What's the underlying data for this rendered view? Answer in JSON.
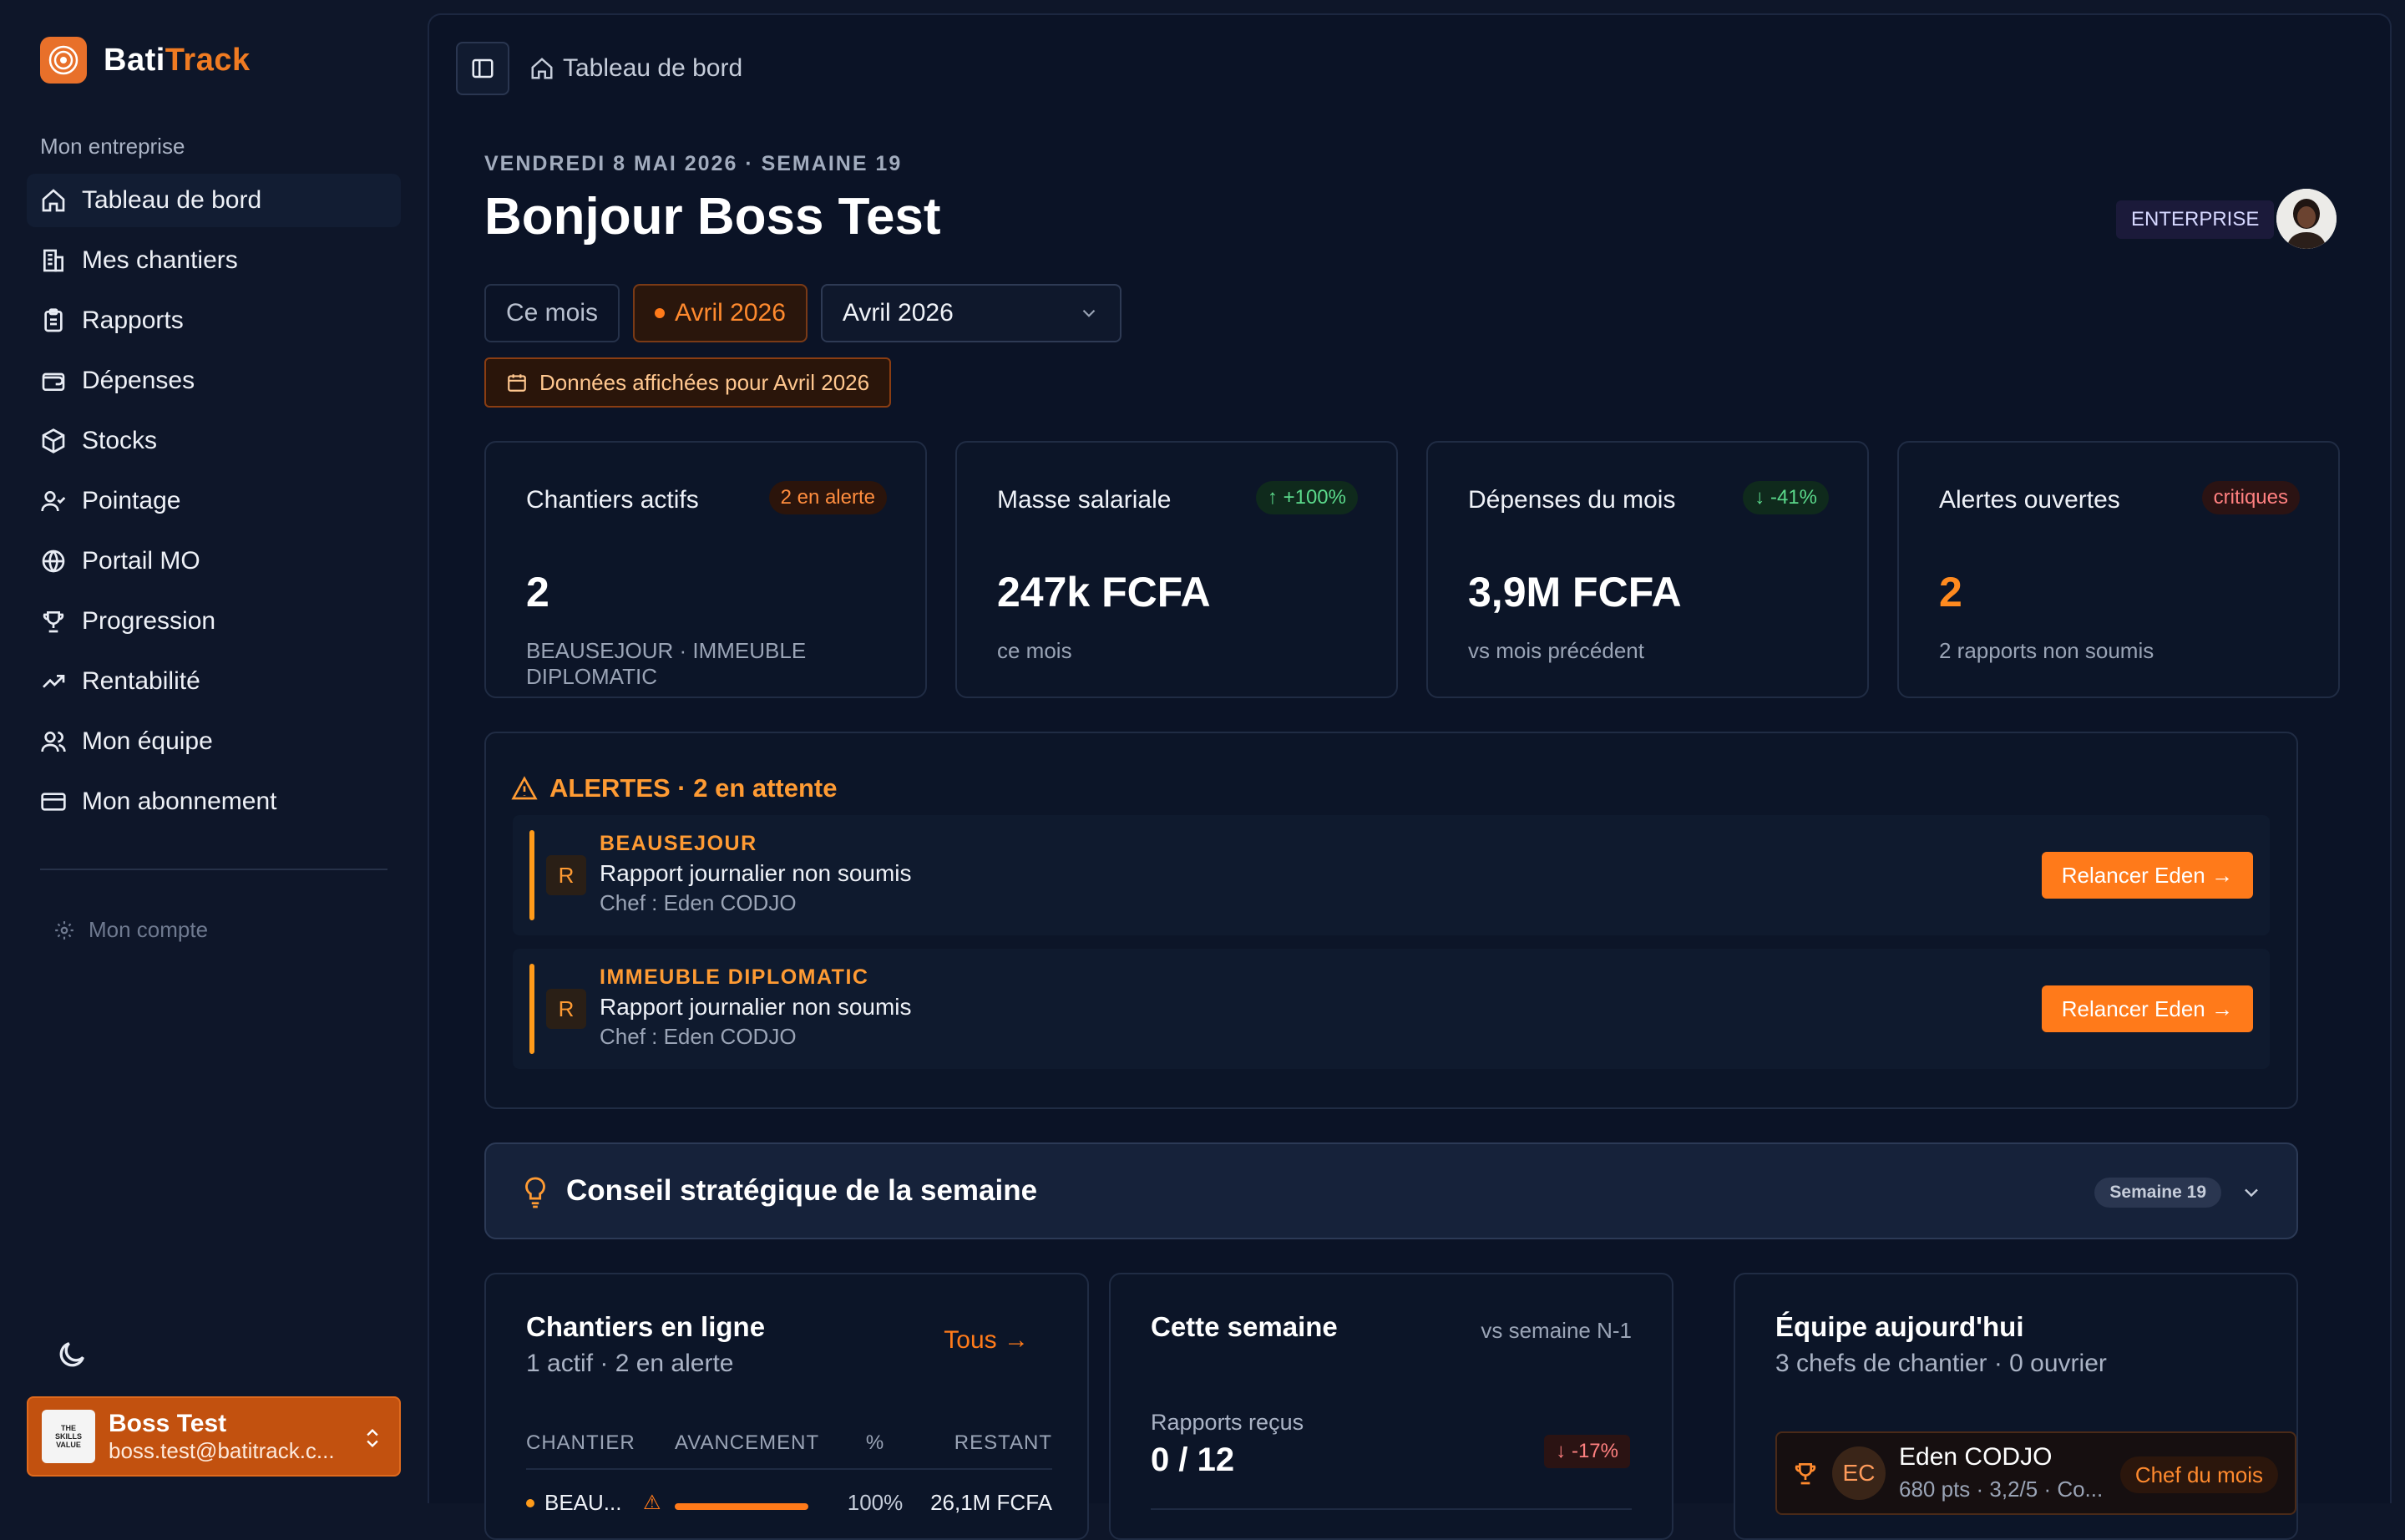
{
  "brand": {
    "part1": "Bati",
    "part2": "Track"
  },
  "sidebar": {
    "section": "Mon entreprise",
    "items": [
      {
        "label": "Tableau de bord",
        "icon": "home-icon"
      },
      {
        "label": "Mes chantiers",
        "icon": "building-icon"
      },
      {
        "label": "Rapports",
        "icon": "clipboard-icon"
      },
      {
        "label": "Dépenses",
        "icon": "wallet-icon"
      },
      {
        "label": "Stocks",
        "icon": "box-icon"
      },
      {
        "label": "Pointage",
        "icon": "user-check-icon"
      },
      {
        "label": "Portail MO",
        "icon": "globe-icon"
      },
      {
        "label": "Progression",
        "icon": "trophy-icon"
      },
      {
        "label": "Rentabilité",
        "icon": "trend-up-icon"
      },
      {
        "label": "Mon équipe",
        "icon": "users-icon"
      },
      {
        "label": "Mon abonnement",
        "icon": "credit-card-icon"
      }
    ],
    "account": "Mon compte"
  },
  "user": {
    "name": "Boss Test",
    "email": "boss.test@batitrack.c...",
    "logo_text": "THE SKILLS VALUE"
  },
  "header": {
    "breadcrumb": "Tableau de bord",
    "date": "VENDREDI 8 MAI 2026 · SEMAINE 19",
    "greeting": "Bonjour Boss Test",
    "plan": "ENTERPRISE"
  },
  "period": {
    "current": "Ce mois",
    "active": "Avril 2026",
    "select": "Avril 2026",
    "notice": "Données affichées pour Avril 2026"
  },
  "kpis": [
    {
      "title": "Chantiers actifs",
      "badge": "2 en alerte",
      "value": "2",
      "sub": "BEAUSEJOUR · IMMEUBLE DIPLOMATIC"
    },
    {
      "title": "Masse salariale",
      "badge": "↑ +100%",
      "value": "247k FCFA",
      "sub": "ce mois"
    },
    {
      "title": "Dépenses du mois",
      "badge": "↓ -41%",
      "value": "3,9M FCFA",
      "sub": "vs mois précédent"
    },
    {
      "title": "Alertes ouvertes",
      "badge": "critiques",
      "value": "2",
      "sub": "2 rapports non soumis"
    }
  ],
  "alerts": {
    "title": "ALERTES · 2 en attente",
    "items": [
      {
        "icon_letter": "R",
        "site": "BEAUSEJOUR",
        "message": "Rapport journalier non soumis",
        "chef": "Chef : Eden CODJO",
        "action": "Relancer Eden →"
      },
      {
        "icon_letter": "R",
        "site": "IMMEUBLE DIPLOMATIC",
        "message": "Rapport journalier non soumis",
        "chef": "Chef : Eden CODJO",
        "action": "Relancer Eden →"
      }
    ]
  },
  "conseil": {
    "title": "Conseil stratégique de la semaine",
    "week": "Semaine 19"
  },
  "chantiers": {
    "title": "Chantiers en ligne",
    "sub": "1 actif · 2 en alerte",
    "link": "Tous →",
    "columns": [
      "CHANTIER",
      "AVANCEMENT",
      "%",
      "RESTANT"
    ],
    "row": {
      "name": "BEAU...",
      "progress": 1.0,
      "percent": "100%",
      "restant": "26,1M FCFA"
    }
  },
  "semaine": {
    "title": "Cette semaine",
    "aside": "vs semaine N-1",
    "stat_label": "Rapports reçus",
    "stat_value": "0 / 12",
    "stat_badge": "↓ -17%"
  },
  "equipe": {
    "title": "Équipe aujourd'hui",
    "sub": "3 chefs de chantier · 0 ouvrier",
    "member": {
      "initials": "EC",
      "name": "Eden CODJO",
      "meta": "680 pts · 3,2/5 · Co...",
      "badge": "Chef du mois"
    }
  },
  "colors": {
    "accent": "#ff7a1a",
    "bg": "#0b1326",
    "card": "#0c1528"
  }
}
